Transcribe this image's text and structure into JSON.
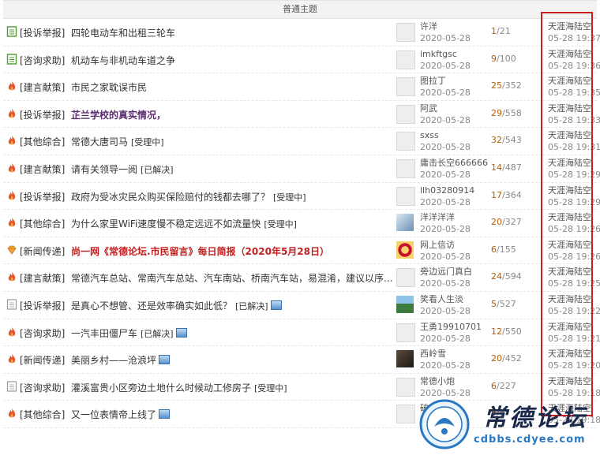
{
  "section_title": "普通主题",
  "colors": {
    "accent_border": "#c81e1e",
    "watermark_text": "#1b2a4a",
    "watermark_url": "#2b78c2"
  },
  "rows": [
    {
      "icon": "doc-green-icon",
      "cat": "[投诉举报]",
      "title": "四轮电动车和出租三轮车",
      "badge": "",
      "img": false,
      "author": "许洋",
      "date": "2020-05-28",
      "replies": "1",
      "views": "21",
      "last_user": "天涯海陆空",
      "last_time": "05-28 19:37",
      "style": "normal",
      "avatar": "blank"
    },
    {
      "icon": "doc-green-icon",
      "cat": "[咨询求助]",
      "title": "机动车与非机动车道之争",
      "badge": "",
      "img": false,
      "author": "imkftgsc",
      "date": "2020-05-28",
      "replies": "9",
      "views": "100",
      "last_user": "天涯海陆空",
      "last_time": "05-28 19:36",
      "style": "normal",
      "avatar": "blank"
    },
    {
      "icon": "fire-icon",
      "cat": "[建言献策]",
      "title": "市民之家耽误市民",
      "badge": "",
      "img": false,
      "author": "图拉丁",
      "date": "2020-05-28",
      "replies": "25",
      "views": "352",
      "last_user": "天涯海陆空",
      "last_time": "05-28 19:35",
      "style": "normal",
      "avatar": "blank"
    },
    {
      "icon": "fire-icon",
      "cat": "[投诉举报]",
      "title": "芷兰学校的真实情况，",
      "badge": "",
      "img": false,
      "author": "阿武",
      "date": "2020-05-28",
      "replies": "29",
      "views": "558",
      "last_user": "天涯海陆空",
      "last_time": "05-28 19:33",
      "style": "bold-purple",
      "avatar": "blank"
    },
    {
      "icon": "fire-icon",
      "cat": "[其他综合]",
      "title": "常德大唐司马",
      "badge": "[受理中]",
      "img": false,
      "author": "sxss",
      "date": "2020-05-28",
      "replies": "32",
      "views": "543",
      "last_user": "天涯海陆空",
      "last_time": "05-28 19:31",
      "style": "normal",
      "avatar": "blank"
    },
    {
      "icon": "fire-icon",
      "cat": "[建言献策]",
      "title": "请有关领导一阅",
      "badge": "[已解决]",
      "img": false,
      "author": "庸击长空666666",
      "date": "2020-05-28",
      "replies": "14",
      "views": "487",
      "last_user": "天涯海陆空",
      "last_time": "05-28 19:29",
      "style": "normal",
      "avatar": "blank"
    },
    {
      "icon": "fire-icon",
      "cat": "[投诉举报]",
      "title": "政府为受冰灾民众购买保险赔付的钱都去哪了？",
      "badge": "[受理中]",
      "img": false,
      "author": "llh03280914",
      "date": "2020-05-28",
      "replies": "17",
      "views": "364",
      "last_user": "天涯海陆空",
      "last_time": "05-28 19:29",
      "style": "normal",
      "avatar": "blank"
    },
    {
      "icon": "fire-icon",
      "cat": "[其他综合]",
      "title": "为什么家里WiFi速度慢不稳定远远不如流量快",
      "badge": "[受理中]",
      "img": false,
      "author": "洋洋洋洋",
      "date": "2020-05-28",
      "replies": "20",
      "views": "327",
      "last_user": "天涯海陆空",
      "last_time": "05-28 19:26",
      "style": "normal",
      "avatar": "pic-blue"
    },
    {
      "icon": "diamond-icon",
      "cat": "[新闻传递]",
      "title": "尚一网《常德论坛.市民留言》每日简报（2020年5月28日）",
      "badge": "",
      "img": false,
      "author": "网上信访",
      "date": "2020-05-28",
      "replies": "6",
      "views": "155",
      "last_user": "天涯海陆空",
      "last_time": "05-28 19:26",
      "style": "bold-red",
      "avatar": "pic-emblem"
    },
    {
      "icon": "fire-icon",
      "cat": "[建言献策]",
      "title": "常德汽车总站、常南汽车总站、汽车南站、桥南汽车站，易混淆，建议以序...",
      "badge": "",
      "img": false,
      "author": "旁边远门真白",
      "date": "2020-05-28",
      "replies": "24",
      "views": "594",
      "last_user": "天涯海陆空",
      "last_time": "05-28 19:25",
      "style": "normal",
      "avatar": "blank"
    },
    {
      "icon": "doc-gray-icon",
      "cat": "[投诉举报]",
      "title": "是真心不想管、还是效率确实如此低？",
      "badge": "[已解决]",
      "img": true,
      "author": "笑看人生淡",
      "date": "2020-05-28",
      "replies": "5",
      "views": "527",
      "last_user": "天涯海陆空",
      "last_time": "05-28 19:22",
      "style": "normal",
      "avatar": "pic-landscape"
    },
    {
      "icon": "fire-icon",
      "cat": "[咨询求助]",
      "title": "一汽丰田僵尸车",
      "badge": "[已解决]",
      "img": true,
      "author": "王勇19910701",
      "date": "2020-05-28",
      "replies": "12",
      "views": "550",
      "last_user": "天涯海陆空",
      "last_time": "05-28 19:21",
      "style": "normal",
      "avatar": "blank"
    },
    {
      "icon": "fire-icon",
      "cat": "[新闻传递]",
      "title": "美丽乡村——沧浪坪",
      "badge": "",
      "img": true,
      "author": "西岭雪",
      "date": "2020-05-28",
      "replies": "20",
      "views": "452",
      "last_user": "天涯海陆空",
      "last_time": "05-28 19:20",
      "style": "normal",
      "avatar": "pic-dark"
    },
    {
      "icon": "doc-gray-icon",
      "cat": "[咨询求助]",
      "title": "灌溪富贵小区旁边土地什么时候动工修房子",
      "badge": "[受理中]",
      "img": false,
      "author": "常德小炮",
      "date": "2020-05-28",
      "replies": "6",
      "views": "227",
      "last_user": "天涯海陆空",
      "last_time": "05-28 19:18",
      "style": "normal",
      "avatar": "blank"
    },
    {
      "icon": "fire-icon",
      "cat": "[其他综合]",
      "title": "又一位表情帝上线了",
      "badge": "",
      "img": true,
      "author": "破晓游路",
      "date": "",
      "replies": "5",
      "views": "5",
      "last_user": "天涯海陆空",
      "last_time": "05-28 19:18",
      "style": "normal",
      "avatar": "blank"
    }
  ],
  "watermark": {
    "brand": "常德论坛",
    "url": "cdbbs.cdyee.com",
    "logo_text": "常德论坛 cdbbs.cdyee.com"
  }
}
